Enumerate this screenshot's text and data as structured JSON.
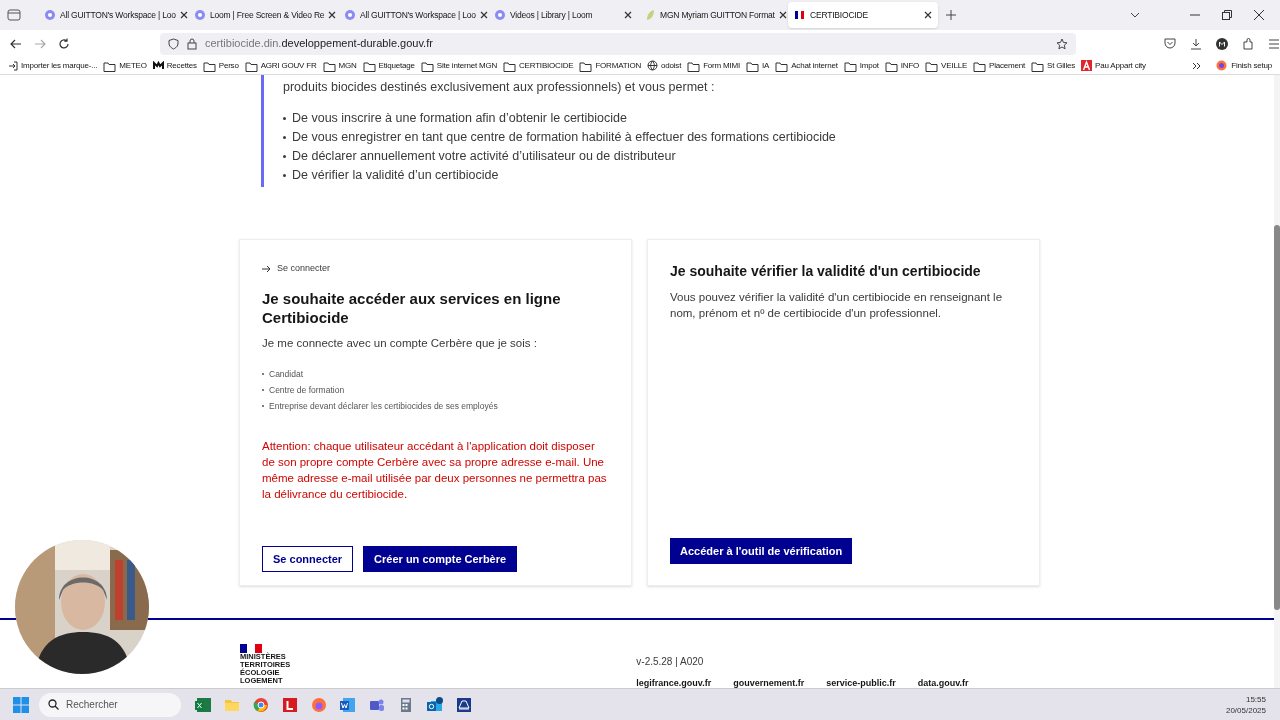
{
  "tabs": [
    {
      "label": "All GUITTON's Workspace | Loo",
      "kind": "loom",
      "selected": false
    },
    {
      "label": "Loom | Free Screen & Video Re",
      "kind": "loom",
      "selected": false
    },
    {
      "label": "All GUITTON's Workspace | Loo",
      "kind": "loom",
      "selected": false
    },
    {
      "label": "Videos | Library | Loom",
      "kind": "loom",
      "selected": false
    },
    {
      "label": "MGN Myriam GUITTON Format",
      "kind": "mgn",
      "selected": false
    },
    {
      "label": "CERTIBIOCIDE",
      "kind": "flag",
      "selected": true
    }
  ],
  "address": {
    "host_prefix": "certibiocide.din.",
    "domain": "developpement-durable.gouv.fr"
  },
  "bookmarks": [
    {
      "label": "Importer les marque-...",
      "kind": "import"
    },
    {
      "label": "METEO",
      "kind": "folder"
    },
    {
      "label": "Recettes",
      "kind": "m"
    },
    {
      "label": "Perso",
      "kind": "folder"
    },
    {
      "label": "AGRI GOUV FR",
      "kind": "folder"
    },
    {
      "label": "MGN",
      "kind": "folder"
    },
    {
      "label": "Etiquetage",
      "kind": "folder"
    },
    {
      "label": "Site internet MGN",
      "kind": "folder"
    },
    {
      "label": "CERTIBIOCIDE",
      "kind": "folder"
    },
    {
      "label": "FORMATION",
      "kind": "folder"
    },
    {
      "label": "odoist",
      "kind": "globe"
    },
    {
      "label": "Form MIMI",
      "kind": "folder"
    },
    {
      "label": "IA",
      "kind": "folder"
    },
    {
      "label": "Achat internet",
      "kind": "folder"
    },
    {
      "label": "Impot",
      "kind": "folder"
    },
    {
      "label": "INFO",
      "kind": "folder"
    },
    {
      "label": "VEILLE",
      "kind": "folder"
    },
    {
      "label": "Placement",
      "kind": "folder"
    },
    {
      "label": "St Gilles",
      "kind": "folder"
    },
    {
      "label": "Pau Appart city",
      "kind": "a"
    }
  ],
  "finish_setup": "Finish setup",
  "intro": {
    "text": "produits biocides destinés exclusivement aux professionnels) et vous permet :",
    "items": [
      "De vous inscrire à une formation afin d’obtenir le certibiocide",
      "De vous enregistrer en tant que centre de formation habilité à effectuer des formations certibiocide",
      "De déclarer annuellement votre activité d’utilisateur ou de distributeur",
      "De vérifier la validité d’un certibiocide"
    ]
  },
  "card_login": {
    "link": "Se connecter",
    "title": "Je souhaite accéder aux services en ligne Certibiocide",
    "lead": "Je me connecte avec un compte Cerbère que je sois :",
    "items": [
      "Candidat",
      "Centre de formation",
      "Entreprise devant déclarer les certibiocides de ses employés"
    ],
    "warning": "Attention: chaque utilisateur accédant à l'application doit disposer de son propre compte Cerbère avec sa propre adresse e-mail. Une même adresse e-mail utilisée par deux personnes ne permettra pas la délivrance du certibiocide.",
    "buttons": [
      {
        "label": "Se connecter",
        "kind": "secondary"
      },
      {
        "label": "Créer un compte Cerbère",
        "kind": "primary"
      }
    ]
  },
  "card_verify": {
    "title": "Je souhaite vérifier la validité d'un certibiocide",
    "text": "Vous pouvez vérifier la validité d'un certibiocide en renseignant le nom, prénom et nº de certibiocide d'un professionnel.",
    "button": "Accéder à l'outil de vérification"
  },
  "footer": {
    "logo_lines": [
      "MINISTÈRES",
      "TERRITOIRES",
      "ÉCOLOGIE",
      "LOGEMENT"
    ],
    "version": "v-2.5.28 | A020",
    "links": [
      "legifrance.gouv.fr",
      "gouvernement.fr",
      "service-public.fr",
      "data.gouv.fr"
    ]
  },
  "taskbar": {
    "search_placeholder": "Rechercher",
    "time": "15:55",
    "date": "20/05/2025"
  }
}
